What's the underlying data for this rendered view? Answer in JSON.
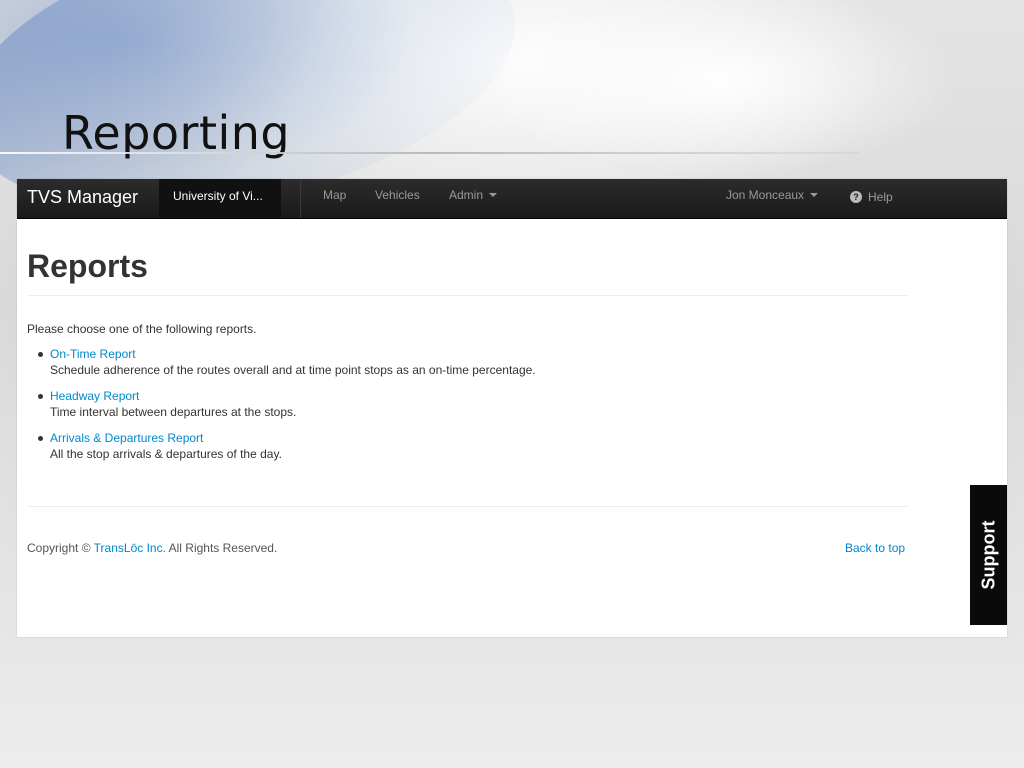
{
  "slide": {
    "title": "Reporting"
  },
  "navbar": {
    "brand": "TVS Manager",
    "organization": "University of Vi...",
    "links": {
      "map": "Map",
      "vehicles": "Vehicles",
      "admin": "Admin"
    },
    "user": "Jon Monceaux",
    "help": "Help"
  },
  "page": {
    "heading": "Reports",
    "intro": "Please choose one of the following reports.",
    "reports": [
      {
        "label": "On-Time Report",
        "description": "Schedule adherence of the routes overall and at time point stops as an on-time percentage."
      },
      {
        "label": "Headway Report",
        "description": "Time interval between departures at the stops."
      },
      {
        "label": "Arrivals & Departures Report",
        "description": "All the stop arrivals & departures of the day."
      }
    ]
  },
  "footer": {
    "copyright_prefix": "Copyright ©",
    "company": "TransLōc Inc.",
    "rights": "All Rights Reserved.",
    "back_to_top": "Back to top"
  },
  "support_tab": {
    "label": "Support"
  },
  "colors": {
    "link": "#0088cc",
    "navbar": "#1b1b1b",
    "support_tab": "#0a0a0a"
  }
}
